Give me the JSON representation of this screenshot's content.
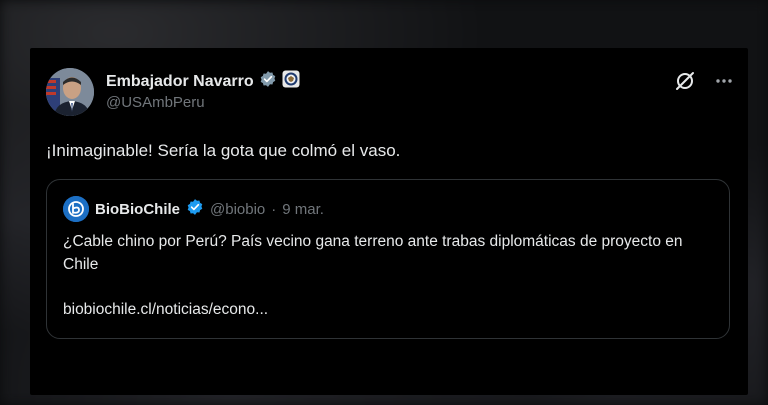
{
  "author": {
    "name": "Embajador Navarro",
    "handle": "@USAmbPeru"
  },
  "tweet": {
    "text": "¡Inimaginable! Sería la gota que colmó el vaso."
  },
  "quoted": {
    "name": "BioBioChile",
    "handle": "@biobio",
    "separator": "·",
    "date": "9 mar.",
    "text": "¿Cable chino por Perú? País vecino gana terreno ante trabas diplomáticas de proyecto en Chile",
    "link": "biobiochile.cl/noticias/econo..."
  },
  "icons": {
    "verified": "verified-badge-icon",
    "seal": "state-department-seal-icon",
    "grok": "grok-icon",
    "more": "more-options-icon"
  },
  "colors": {
    "background": "#000000",
    "text_primary": "#e7e9ea",
    "text_secondary": "#71767b",
    "verified_blue": "#1d9bf0",
    "gray_check": "#829aab",
    "border": "#2f3336"
  }
}
